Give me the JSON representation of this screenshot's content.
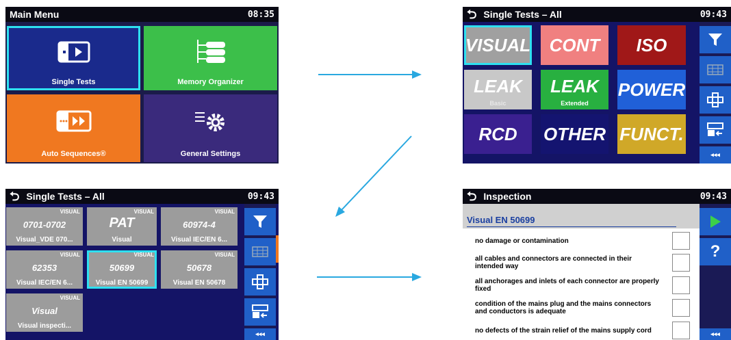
{
  "arrow_color": "#29a8e0",
  "main_menu": {
    "title": "Main Menu",
    "time": "08:35",
    "tiles": [
      {
        "label": "Single Tests",
        "color": "#1a2a8c",
        "icon": "single-tests-icon"
      },
      {
        "label": "Memory Organizer",
        "color": "#3cbf4a",
        "icon": "memory-tree-icon"
      },
      {
        "label": "Auto Sequences®",
        "color": "#f07820",
        "icon": "auto-sequence-icon"
      },
      {
        "label": "General Settings",
        "color": "#3a2a7c",
        "icon": "settings-gear-icon"
      }
    ]
  },
  "single_tests": {
    "title": "Single Tests – All",
    "time": "09:43",
    "tiles": [
      {
        "label": "VISUAL",
        "sub": "",
        "color": "#a0a0a0"
      },
      {
        "label": "CONT",
        "sub": "",
        "color": "#f08080"
      },
      {
        "label": "ISO",
        "sub": "",
        "color": "#a01818"
      },
      {
        "label": "LEAK",
        "sub": "Basic",
        "color": "#c8c8c8"
      },
      {
        "label": "LEAK",
        "sub": "Extended",
        "color": "#28b040"
      },
      {
        "label": "POWER",
        "sub": "",
        "color": "#2060d8"
      },
      {
        "label": "RCD",
        "sub": "",
        "color": "#3a2090"
      },
      {
        "label": "OTHER",
        "sub": "",
        "color": "#141470"
      },
      {
        "label": "FUNCT.",
        "sub": "",
        "color": "#d0a828"
      }
    ],
    "side_buttons": [
      "filter-icon",
      "grid-view-icon",
      "move-icon",
      "recall-icon"
    ],
    "more_label": "◂◂◂"
  },
  "visual_list": {
    "title": "Single Tests – All",
    "time": "09:43",
    "tiles": [
      {
        "tag": "VISUAL",
        "mid": "0701-0702",
        "bot": "Visual_VDE 070..."
      },
      {
        "tag": "VISUAL",
        "mid": "PAT",
        "bot": "Visual"
      },
      {
        "tag": "VISUAL",
        "mid": "60974-4",
        "bot": "Visual IEC/EN 6..."
      },
      {
        "tag": "VISUAL",
        "mid": "62353",
        "bot": "Visual IEC/EN 6..."
      },
      {
        "tag": "VISUAL",
        "mid": "50699",
        "bot": "Visual EN 50699"
      },
      {
        "tag": "VISUAL",
        "mid": "50678",
        "bot": "Visual EN 50678"
      },
      {
        "tag": "VISUAL",
        "mid": "Visual",
        "bot": "Visual inspecti..."
      }
    ],
    "more_label": "◂◂◂"
  },
  "inspection": {
    "title": "Inspection",
    "time": "09:43",
    "header": "Visual EN 50699",
    "items": [
      "no damage or contamination",
      "all cables and connectors are connected in their intended way",
      "all anchorages and inlets of each connector are properly fixed",
      "condition of the mains plug and the mains connectors and conductors is adequate",
      "no defects of the strain relief of the mains supply cord"
    ],
    "help_label": "?",
    "more_label": "◂◂◂"
  }
}
